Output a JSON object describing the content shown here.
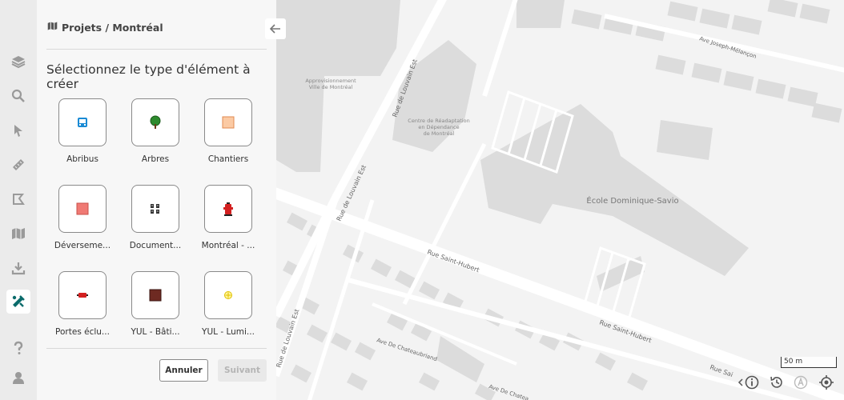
{
  "breadcrumb": "Projets / Montréal",
  "heading": "Sélectionnez le type d'élément à créer",
  "elements": [
    {
      "label": "Abribus",
      "icon": "bus-stop-icon"
    },
    {
      "label": "Arbres",
      "icon": "tree-icon"
    },
    {
      "label": "Chantiers",
      "icon": "construction-square-icon"
    },
    {
      "label": "Déverseme...",
      "icon": "overflow-square-icon"
    },
    {
      "label": "Document...",
      "icon": "documents-icon"
    },
    {
      "label": "Montréal - ...",
      "icon": "fire-hydrant-icon"
    },
    {
      "label": "Portes éclu...",
      "icon": "lock-gate-icon"
    },
    {
      "label": "YUL - Bâti...",
      "icon": "building-square-icon"
    },
    {
      "label": "YUL - Lumi...",
      "icon": "light-icon"
    }
  ],
  "buttons": {
    "cancel": "Annuler",
    "next": "Suivant"
  },
  "map": {
    "labels": {
      "approv1": "Approvisionnement",
      "approv2": "Ville de Montréal",
      "centre1": "Centre de Réadaptation",
      "centre2": "en Dépendance",
      "centre3": "de Montréal",
      "ecole": "École Dominique-Savio",
      "louvain1": "Rue de Louvain Est",
      "louvain2": "Rue de Louvain Est",
      "louvain3": "Rue de Louvain Est",
      "sthubert1": "Rue Saint-Hubert",
      "sthubert2": "Rue Saint-Hubert",
      "sthubert3": "Rue Sai",
      "melancon": "Ave Joseph-Mélançon",
      "chateau1": "Ave De Chateaubriand",
      "chateau2": "Ave De Chatea"
    },
    "scale": "50 m"
  },
  "colors": {
    "accent": "#0a6b6b",
    "road": "#ffffff",
    "building": "#dcdcdc",
    "background": "#f3f3f3"
  }
}
